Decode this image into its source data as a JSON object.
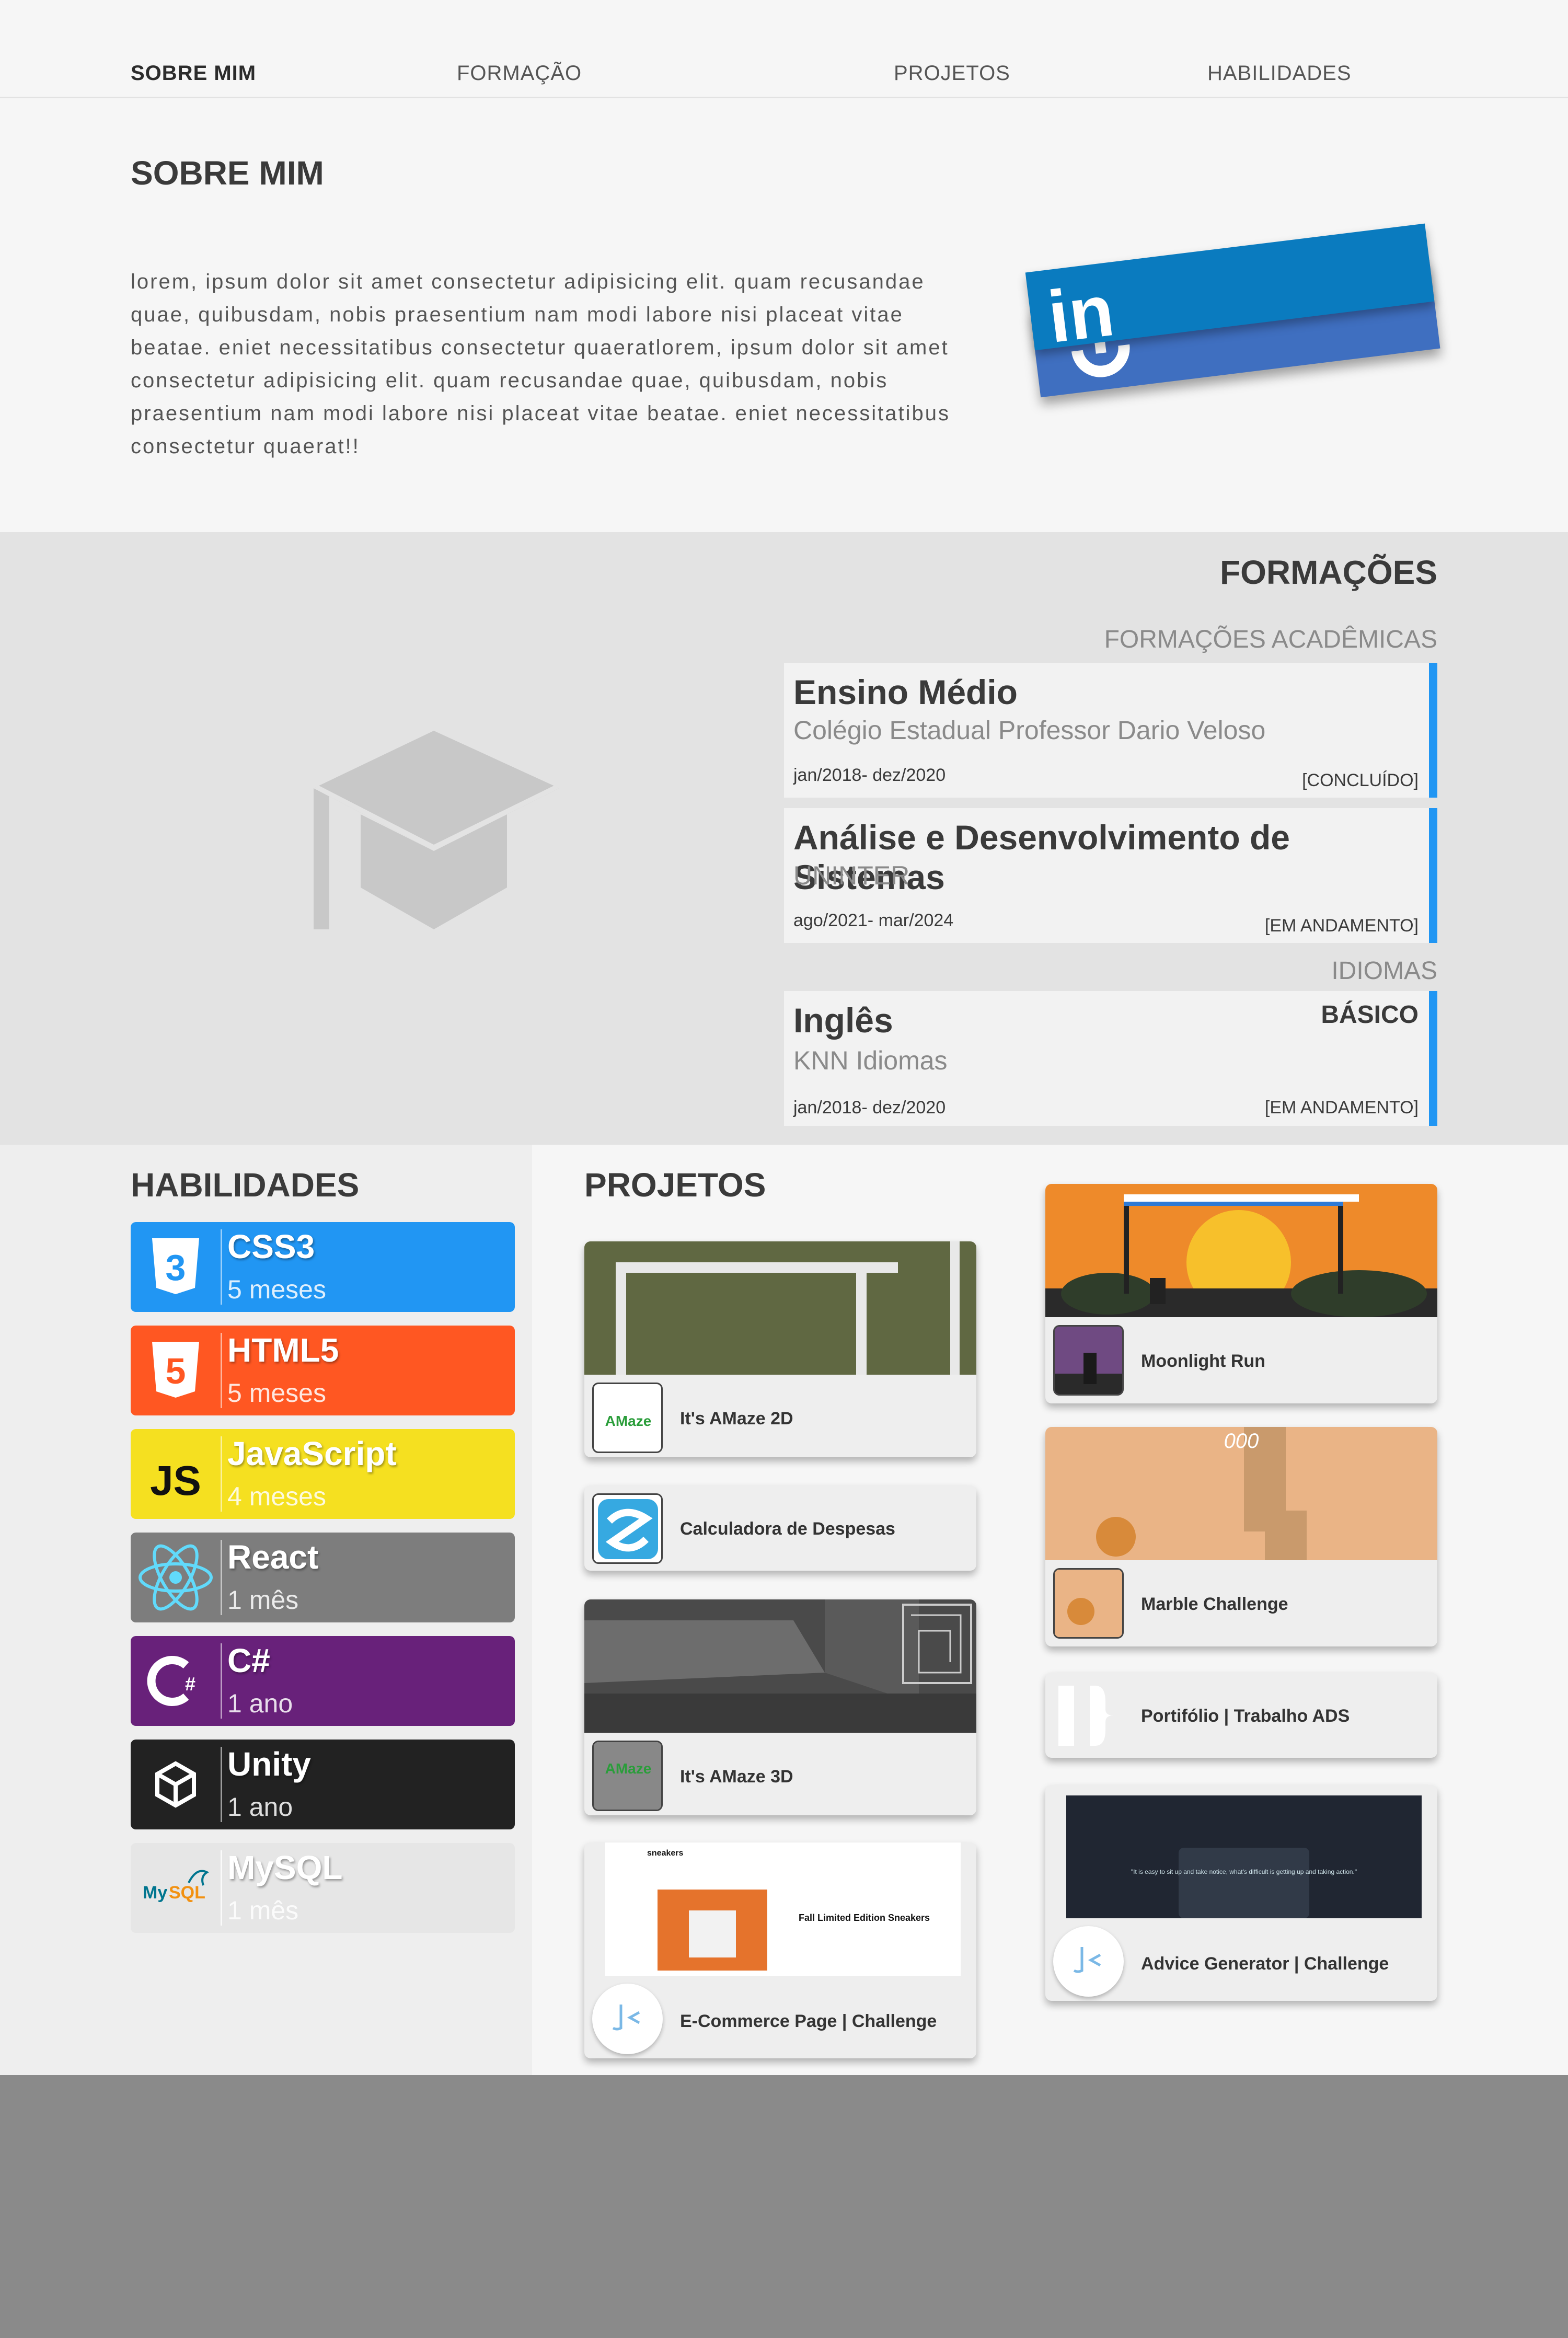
{
  "nav": {
    "items": [
      "SOBRE MIM",
      "FORMAÇÃO",
      "PROJETOS",
      "HABILIDADES"
    ]
  },
  "about": {
    "title": "SOBRE MIM",
    "text": "lorem, ipsum dolor sit amet consectetur adipisicing elit. quam recusandae quae, quibusdam, nobis praesentium nam modi labore nisi placeat vitae beatae. eniet necessitatibus consectetur quaeratlorem, ipsum dolor sit amet consectetur adipisicing elit. quam recusandae quae, quibusdam, nobis praesentium nam modi labore nisi placeat vitae beatae. eniet necessitatibus consectetur quaerat!!",
    "linkedin_label": "in",
    "colors": {
      "linkedin": "#0a7bbf",
      "github": "#3f6fc0"
    }
  },
  "formacoes": {
    "title": "FORMAÇÕES",
    "academic_label": "FORMAÇÕES ACADÊMICAS",
    "languages_label": "IDIOMAS",
    "academic": [
      {
        "course": "Ensino Médio",
        "institution": "Colégio Estadual Professor Dario Veloso",
        "dates": "jan/2018- dez/2020",
        "status": "[CONCLUÍDO]"
      },
      {
        "course": "Análise e Desenvolvimento de Sistemas",
        "institution": "UNINTER",
        "dates": "ago/2021- mar/2024",
        "status": "[EM ANDAMENTO]"
      }
    ],
    "languages": [
      {
        "language": "Inglês",
        "level": "BÁSICO",
        "institution": "KNN Idiomas",
        "dates": "jan/2018- dez/2020",
        "status": "[EM ANDAMENTO]"
      }
    ],
    "accent_color": "#2196f3"
  },
  "skills": {
    "title": "HABILIDADES",
    "items": [
      {
        "name": "CSS3",
        "duration": "5 meses",
        "color": "#2196f3",
        "icon": "css3-icon"
      },
      {
        "name": "HTML5",
        "duration": "5 meses",
        "color": "#ff5722",
        "icon": "html5-icon"
      },
      {
        "name": "JavaScript",
        "duration": "4 meses",
        "color": "#f5e020",
        "icon": "javascript-icon"
      },
      {
        "name": "React",
        "duration": "1 mês",
        "color": "#7d7d7d",
        "icon": "react-icon"
      },
      {
        "name": "C#",
        "duration": "1 ano",
        "color": "#68217a",
        "icon": "csharp-icon"
      },
      {
        "name": "Unity",
        "duration": "1 ano",
        "color": "#222222",
        "icon": "unity-icon"
      },
      {
        "name": "MySQL",
        "duration": "1 mês",
        "color": "#e6e6e6",
        "icon": "mysql-icon"
      }
    ]
  },
  "projects": {
    "title": "PROJETOS",
    "items": [
      {
        "name": "It's AMaze 2D"
      },
      {
        "name": "Calculadora de Despesas"
      },
      {
        "name": "It's AMaze 3D"
      },
      {
        "name": "E-Commerce Page | Challenge"
      },
      {
        "name": "Moonlight Run"
      },
      {
        "name": "Marble Challenge"
      },
      {
        "name": "Portifólio | Trabalho ADS"
      },
      {
        "name": "Advice Generator | Challenge"
      }
    ],
    "preview_texts": {
      "logo": "AMaze",
      "ecommerce_brand": "sneakers",
      "ecommerce_heading": "Fall Limited Edition Sneakers",
      "marble_score": "000",
      "advice_text": "\"It is easy to sit up and take notice, what's difficult is getting up and taking action.\""
    }
  }
}
